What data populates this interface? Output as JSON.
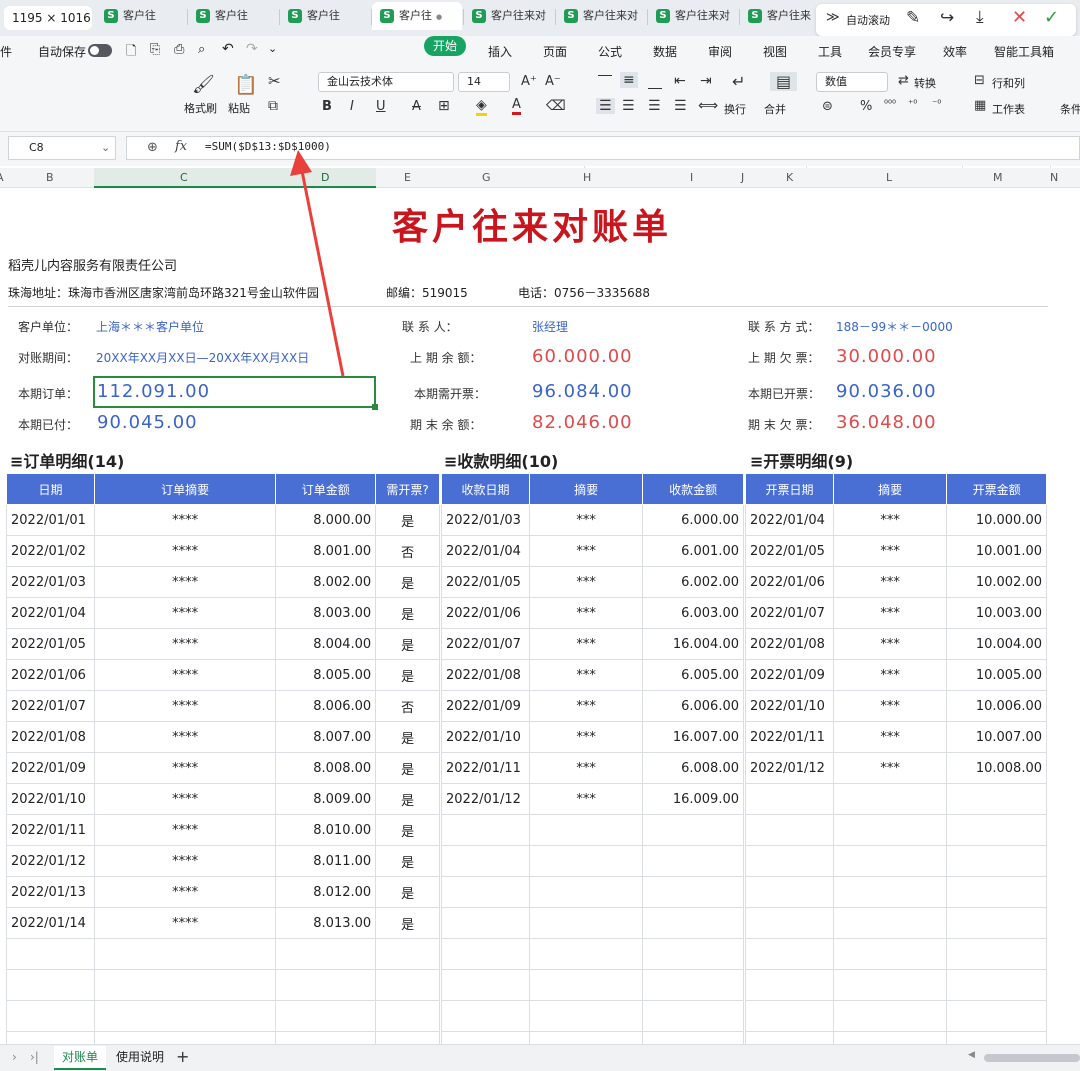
{
  "window": {
    "dimensions_label": "1195 × 1016"
  },
  "tabs": [
    {
      "label": "客户往",
      "active": false
    },
    {
      "label": "客户往",
      "active": false
    },
    {
      "label": "客户往",
      "active": false
    },
    {
      "label": "客户往",
      "active": true
    },
    {
      "label": "客户往来对",
      "active": false
    },
    {
      "label": "客户往来对",
      "active": false
    },
    {
      "label": "客户往来对",
      "active": false
    },
    {
      "label": "客户往来",
      "active": false
    }
  ],
  "topright": {
    "auto_scroll": "自动滚动"
  },
  "menu": {
    "file": "文件",
    "autosave": "自动保存",
    "items": [
      "开始",
      "插入",
      "页面",
      "公式",
      "数据",
      "审阅",
      "视图",
      "工具",
      "会员专享",
      "效率",
      "智能工具箱"
    ]
  },
  "ribbon": {
    "format_painter": "格式刷",
    "paste": "粘贴",
    "font": "金山云技术体",
    "font_size": "14",
    "number_format": "数值",
    "convert": "转换",
    "rows_cols": "行和列",
    "worksheet": "工作表",
    "wrap": "换行",
    "merge": "合并",
    "condition": "条件"
  },
  "formula_bar": {
    "cell": "C8",
    "formula": "=SUM($D$13:$D$1000)"
  },
  "columns": [
    "A",
    "B",
    "C",
    "D",
    "E",
    "G",
    "H",
    "I",
    "J",
    "K",
    "L",
    "M",
    "N"
  ],
  "sheet": {
    "title": "客户往来对账单",
    "company": "稻壳儿内容服务有限责任公司",
    "address": "珠海地址：珠海市香洲区唐家湾前岛环路321号金山软件园",
    "postcode": "邮编：519015",
    "phone": "电话：0756－3335688",
    "customer_label": "客户单位：",
    "customer": "上海＊＊＊客户单位",
    "contact_label": "联    系    人：",
    "contact": "张经理",
    "contact_way_label": "联 系 方 式：",
    "contact_way": "188－99＊＊－0000",
    "period_label": "对账期间：",
    "period": "20XX年XX月XX日—20XX年XX月XX日",
    "prev_balance_label": "上 期 余 额：",
    "prev_balance": "60.000.00",
    "prev_owed_label": "上 期 欠 票：",
    "prev_owed": "30.000.00",
    "orders_label": "本期订单：",
    "orders": "112.091.00",
    "need_invoice_label": "本期需开票：",
    "need_invoice": "96.084.00",
    "issued_label": "本期已开票：",
    "issued": "90.036.00",
    "paid_label": "本期已付：",
    "paid": "90.045.00",
    "end_balance_label": "期 末 余 额：",
    "end_balance": "82.046.00",
    "end_owed_label": "期 末 欠 票：",
    "end_owed": "36.048.00"
  },
  "sections": {
    "orders": "≡订单明细(14)",
    "receipts": "≡收款明细(10)",
    "invoices": "≡开票明细(9)"
  },
  "orders_table": {
    "headers": [
      "日期",
      "订单摘要",
      "订单金额",
      "需开票?"
    ],
    "rows": [
      [
        "2022/01/01",
        "****",
        "8.000.00",
        "是"
      ],
      [
        "2022/01/02",
        "****",
        "8.001.00",
        "否"
      ],
      [
        "2022/01/03",
        "****",
        "8.002.00",
        "是"
      ],
      [
        "2022/01/04",
        "****",
        "8.003.00",
        "是"
      ],
      [
        "2022/01/05",
        "****",
        "8.004.00",
        "是"
      ],
      [
        "2022/01/06",
        "****",
        "8.005.00",
        "是"
      ],
      [
        "2022/01/07",
        "****",
        "8.006.00",
        "否"
      ],
      [
        "2022/01/08",
        "****",
        "8.007.00",
        "是"
      ],
      [
        "2022/01/09",
        "****",
        "8.008.00",
        "是"
      ],
      [
        "2022/01/10",
        "****",
        "8.009.00",
        "是"
      ],
      [
        "2022/01/11",
        "****",
        "8.010.00",
        "是"
      ],
      [
        "2022/01/12",
        "****",
        "8.011.00",
        "是"
      ],
      [
        "2022/01/13",
        "****",
        "8.012.00",
        "是"
      ],
      [
        "2022/01/14",
        "****",
        "8.013.00",
        "是"
      ]
    ]
  },
  "receipts_table": {
    "headers": [
      "收款日期",
      "摘要",
      "收款金额"
    ],
    "rows": [
      [
        "2022/01/03",
        "***",
        "6.000.00"
      ],
      [
        "2022/01/04",
        "***",
        "6.001.00"
      ],
      [
        "2022/01/05",
        "***",
        "6.002.00"
      ],
      [
        "2022/01/06",
        "***",
        "6.003.00"
      ],
      [
        "2022/01/07",
        "***",
        "16.004.00"
      ],
      [
        "2022/01/08",
        "***",
        "6.005.00"
      ],
      [
        "2022/01/09",
        "***",
        "6.006.00"
      ],
      [
        "2022/01/10",
        "***",
        "16.007.00"
      ],
      [
        "2022/01/11",
        "***",
        "6.008.00"
      ],
      [
        "2022/01/12",
        "***",
        "16.009.00"
      ]
    ]
  },
  "invoices_table": {
    "headers": [
      "开票日期",
      "摘要",
      "开票金额"
    ],
    "rows": [
      [
        "2022/01/04",
        "***",
        "10.000.00"
      ],
      [
        "2022/01/05",
        "***",
        "10.001.00"
      ],
      [
        "2022/01/06",
        "***",
        "10.002.00"
      ],
      [
        "2022/01/07",
        "***",
        "10.003.00"
      ],
      [
        "2022/01/08",
        "***",
        "10.004.00"
      ],
      [
        "2022/01/09",
        "***",
        "10.005.00"
      ],
      [
        "2022/01/10",
        "***",
        "10.006.00"
      ],
      [
        "2022/01/11",
        "***",
        "10.007.00"
      ],
      [
        "2022/01/12",
        "***",
        "10.008.00"
      ]
    ]
  },
  "sheet_tabs": [
    "对账单",
    "使用说明"
  ],
  "colors": {
    "accent_green": "#17a463",
    "title_red": "#c9151e",
    "header_blue": "#4a6fd4",
    "value_blue": "#3a64c8",
    "value_red": "#e04a4a",
    "arrow_red": "#e8403a"
  }
}
